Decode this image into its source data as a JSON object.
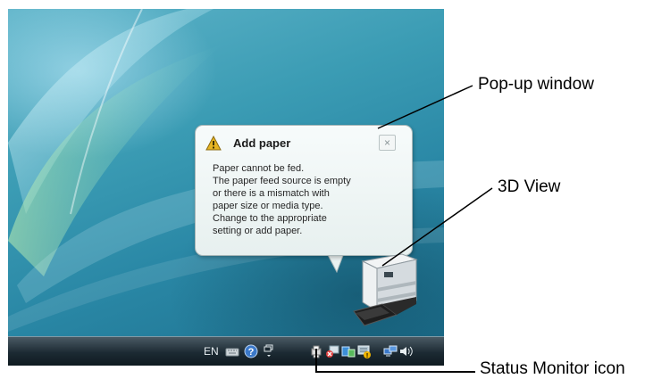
{
  "popup": {
    "title": "Add paper",
    "close_glyph": "×",
    "icon": "warning-icon",
    "lines": [
      "Paper cannot be fed.",
      "The paper feed source is empty",
      "or there is a mismatch with",
      "paper size or media type.",
      "Change to the appropriate",
      "setting or add paper."
    ]
  },
  "taskbar": {
    "language": "EN",
    "icons": [
      "keyboard-icon",
      "help-icon",
      "windows-icon",
      "status-monitor-icon",
      "network-icon",
      "devices-icon",
      "printer-tray-icon",
      "network-monitor-icon",
      "volume-icon"
    ]
  },
  "callouts": {
    "popup_window": "Pop-up window",
    "view_3d": "3D View",
    "status_monitor_icon": "Status Monitor icon"
  },
  "colors": {
    "desktop_teal": "#2a88a6",
    "taskbar_dark": "#1c2a33",
    "popup_background": "#f7fbfb",
    "warning_yellow": "#e6b422"
  }
}
